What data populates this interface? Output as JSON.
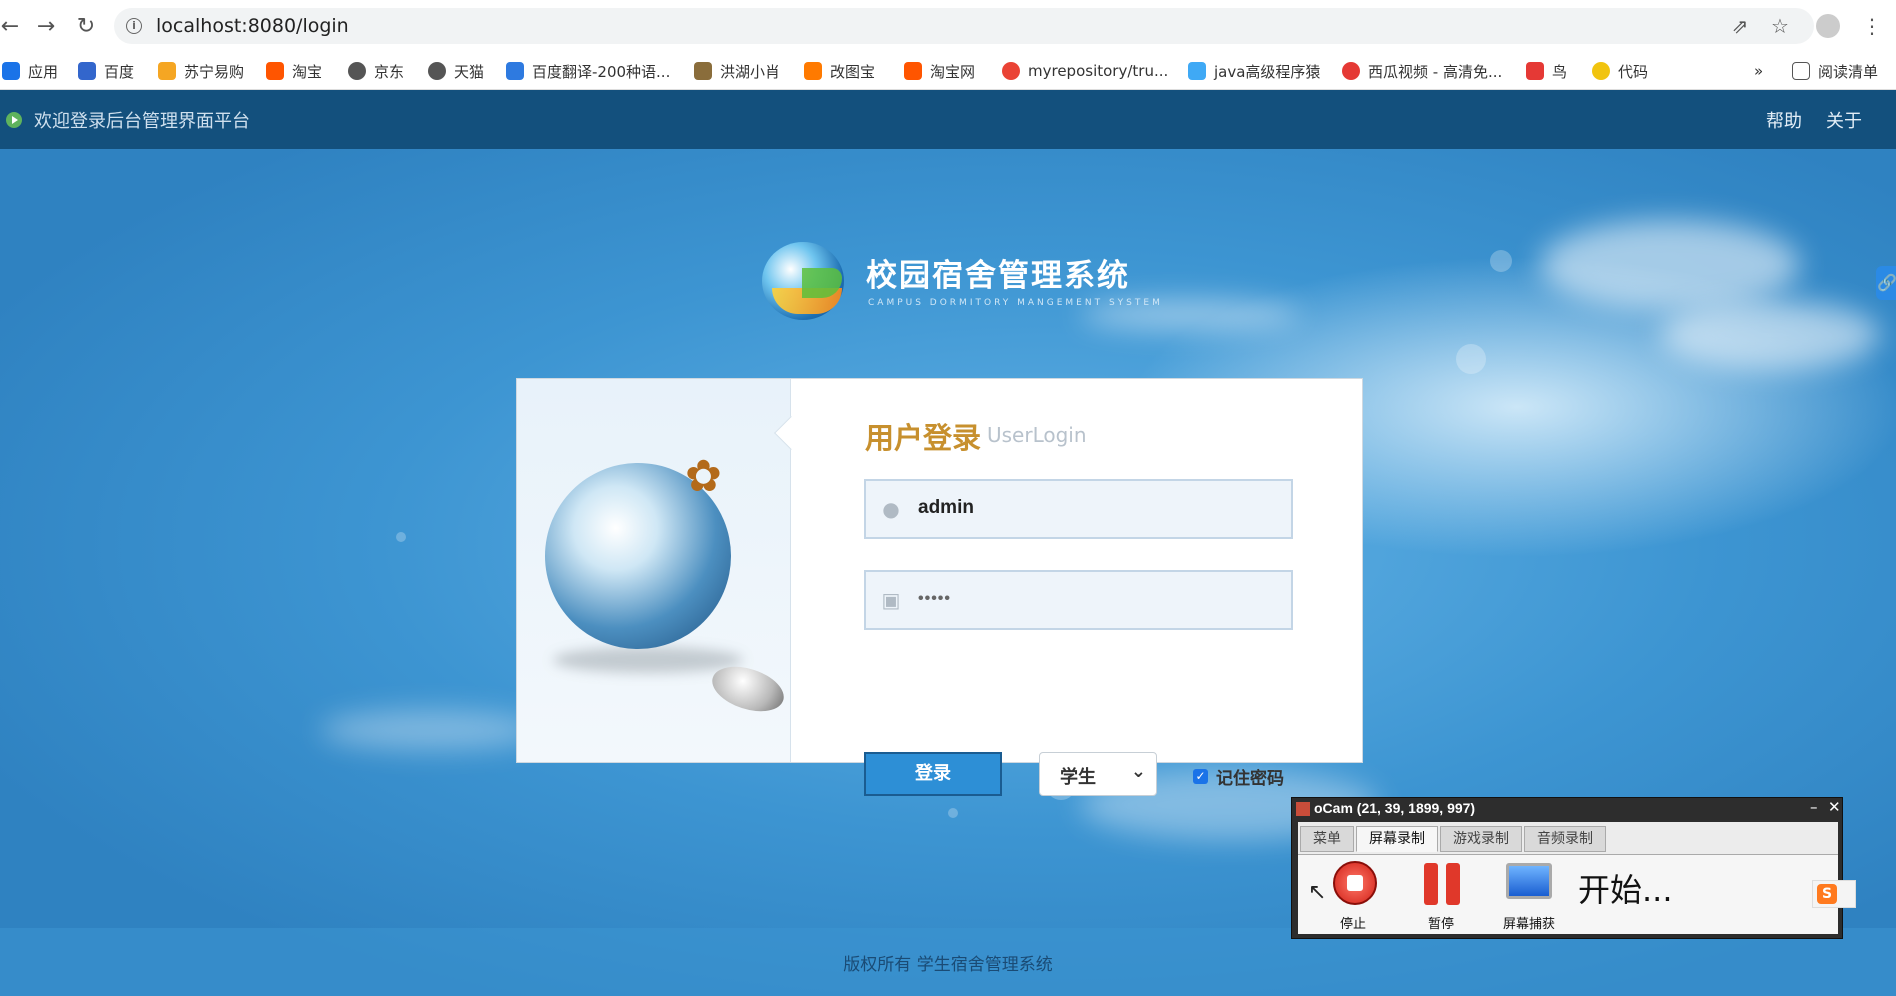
{
  "browser": {
    "url": "localhost:8080/login",
    "bookmarks": [
      {
        "label": "应用",
        "color": "#1a73e8"
      },
      {
        "label": "百度",
        "color": "#3366cc"
      },
      {
        "label": "苏宁易购",
        "color": "#f5a623"
      },
      {
        "label": "淘宝",
        "color": "#ff5500"
      },
      {
        "label": "京东",
        "color": "#555555"
      },
      {
        "label": "天猫",
        "color": "#555555"
      },
      {
        "label": "百度翻译-200种语...",
        "color": "#2e7ae0"
      },
      {
        "label": "洪湖小肖",
        "color": "#8a6d3b"
      },
      {
        "label": "改图宝",
        "color": "#ff7a00"
      },
      {
        "label": "淘宝网",
        "color": "#ff5500"
      },
      {
        "label": "myrepository/tru...",
        "color": "#ea4335"
      },
      {
        "label": "java高级程序猿",
        "color": "#3fa9f5"
      },
      {
        "label": "西瓜视频 - 高清免...",
        "color": "#e53935"
      },
      {
        "label": "鸟",
        "color": "#e53935"
      },
      {
        "label": "代码",
        "color": "#f1c40f"
      }
    ],
    "bookmarks_more": "»",
    "reading_list": "阅读清单"
  },
  "topnav": {
    "title": "欢迎登录后台管理界面平台",
    "help": "帮助",
    "about": "关于"
  },
  "logo": {
    "name": "校园宿舍管理系统",
    "subtitle": "CAMPUS DORMITORY MANGEMENT SYSTEM"
  },
  "login": {
    "title": "用户登录",
    "title_en": "UserLogin",
    "username": "admin",
    "password_mask": "•••••",
    "submit_label": "登录",
    "role_selected": "学生",
    "remember_label": "记住密码",
    "remember_checked": true
  },
  "footer": {
    "text": "版权所有 学生宿舍管理系统"
  },
  "ocam": {
    "title": "oCam (21, 39, 1899, 997)",
    "tabs": [
      "菜单",
      "屏幕录制",
      "游戏录制",
      "音频录制"
    ],
    "active_tab": "屏幕录制",
    "stop_label": "停止",
    "pause_label": "暂停",
    "capture_label": "屏幕捕获",
    "status": "开始..."
  },
  "colors": {
    "nav_bg": "#13507d",
    "accent": "#2d8fd6",
    "title_gold": "#c7902e"
  }
}
